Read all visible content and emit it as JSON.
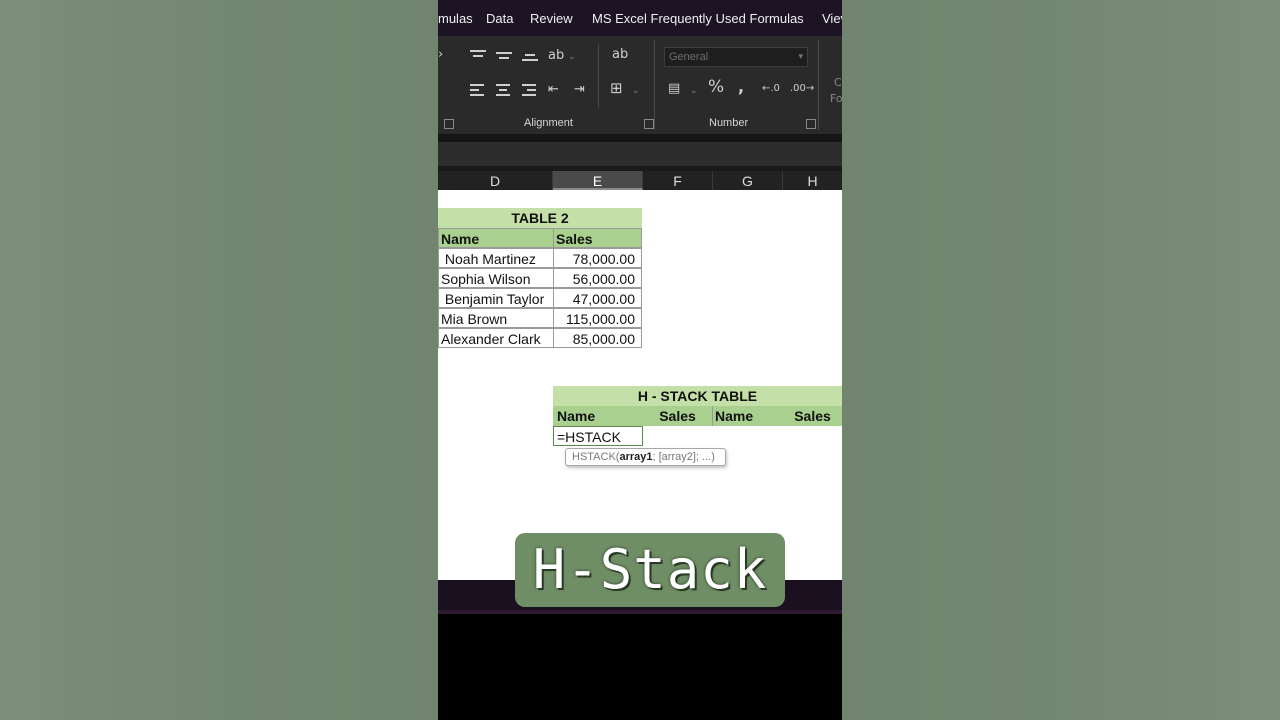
{
  "ribbon": {
    "tabs": [
      "mulas",
      "Data",
      "Review",
      "MS Excel Frequently Used Formulas",
      "Viev"
    ],
    "number_format": "General",
    "group_alignment": "Alignment",
    "group_number": "Number",
    "edge_fragment_top": "C",
    "edge_fragment_bottom": "Fo"
  },
  "columns": [
    "D",
    "E",
    "F",
    "G",
    "H"
  ],
  "active_column": "E",
  "table2": {
    "title": "TABLE 2",
    "headers": [
      "Name",
      "Sales"
    ],
    "rows": [
      {
        "name": " Noah Martinez",
        "sales": "78,000.00"
      },
      {
        "name": "Sophia Wilson",
        "sales": "56,000.00"
      },
      {
        "name": " Benjamin Taylor",
        "sales": "47,000.00"
      },
      {
        "name": "Mia Brown",
        "sales": "115,000.00"
      },
      {
        "name": "Alexander Clark",
        "sales": "85,000.00"
      }
    ]
  },
  "hstack": {
    "title": "H - STACK TABLE",
    "headers": [
      "Name",
      "Sales",
      "Name",
      "Sales"
    ],
    "formula": "=HSTACK",
    "tooltip_fn": "HSTACK(",
    "tooltip_arg1": "array1",
    "tooltip_rest": "; [array2]; ...)"
  },
  "caption": "H-Stack"
}
